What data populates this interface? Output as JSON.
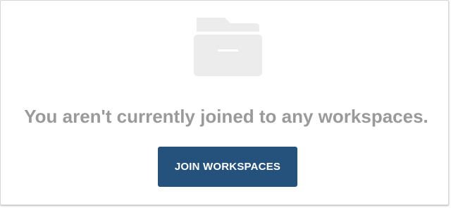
{
  "empty_state": {
    "icon": "folder-icon",
    "message": "You aren't currently joined to any workspaces.",
    "action_label": "JOIN WORKSPACES"
  },
  "colors": {
    "icon": "#ececec",
    "message": "#9a9a9a",
    "button_background": "#25527d",
    "button_text": "#ffffff",
    "panel_border": "#d6d6d6"
  }
}
